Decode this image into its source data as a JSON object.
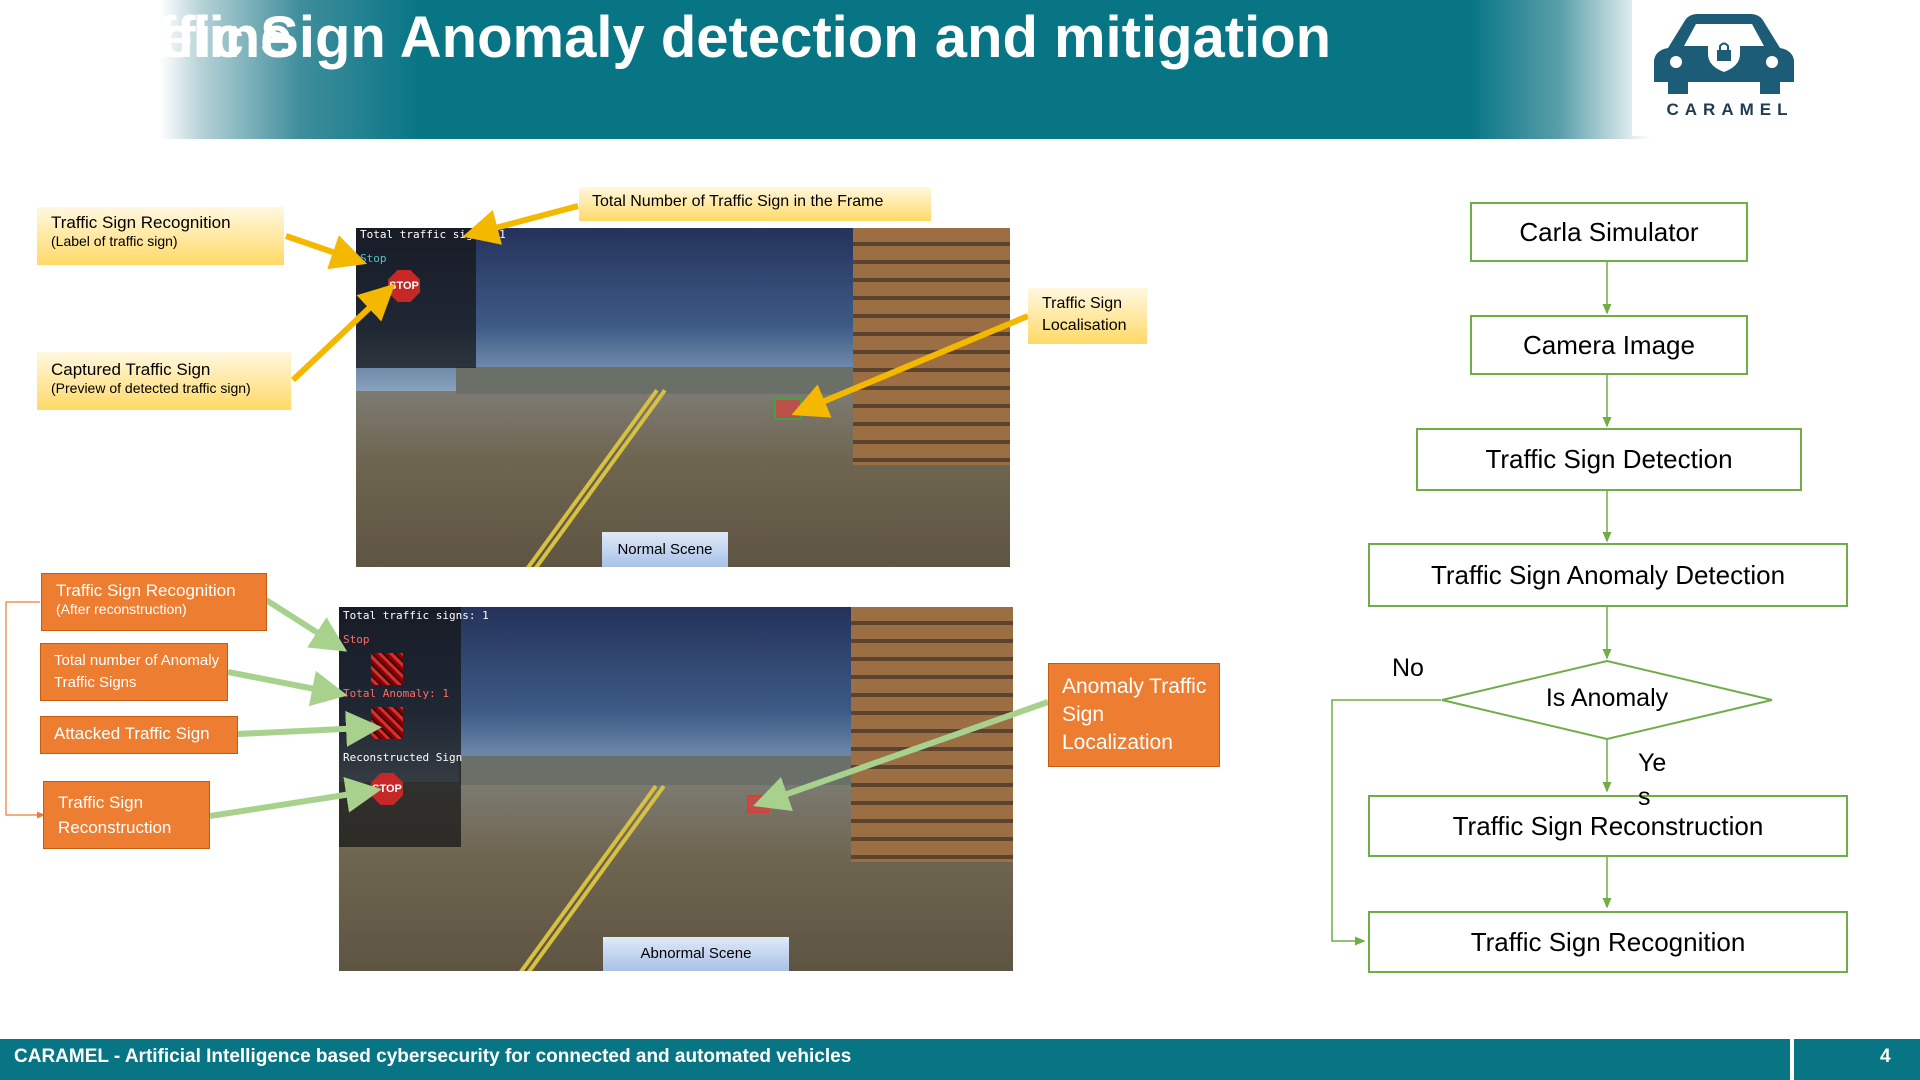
{
  "header": {
    "title_line1": "Traffic Sign Anomaly detection and mitigation",
    "title_line2": "Pipeline",
    "logo_text": "CARAMEL",
    "logo_icon": "car-lock-icon"
  },
  "normal_scene": {
    "overlay_total": "Total traffic signs: 1",
    "overlay_label": "Stop",
    "stop_text": "STOP",
    "bbox_text": "STOP",
    "caption": "Normal Scene"
  },
  "abnormal_scene": {
    "overlay_total": "Total traffic signs: 1",
    "overlay_label": "Stop",
    "overlay_anomaly": "Total Anomaly: 1",
    "overlay_reconstructed": "Reconstructed Sign",
    "stop_text": "STOP",
    "caption": "Abnormal Scene"
  },
  "annotations": {
    "tsr_main": "Traffic Sign Recognition",
    "tsr_sub": "(Label of traffic sign)",
    "captured_main": "Captured Traffic Sign",
    "captured_sub": "(Preview of detected traffic sign)",
    "total_frame": "Total Number of Traffic Sign in the Frame",
    "localisation": "Traffic Sign Localisation",
    "tsr_after_main": "Traffic Sign Recognition",
    "tsr_after_sub": "(After reconstruction)",
    "total_anomaly": "Total number of Anomaly Traffic Signs",
    "attacked": "Attacked Traffic Sign",
    "reconstruction": "Traffic Sign Reconstruction",
    "anomaly_localization": "Anomaly Traffic Sign Localization"
  },
  "flowchart": {
    "steps": [
      "Carla Simulator",
      "Camera Image",
      "Traffic Sign Detection",
      "Traffic Sign Anomaly Detection",
      "Is Anomaly",
      "Traffic Sign Reconstruction",
      "Traffic Sign Recognition"
    ],
    "no_label": "No",
    "yes_label_a": "Ye",
    "yes_label_b": "s"
  },
  "footer": {
    "text": "CARAMEL - Artificial Intelligence based cybersecurity for connected and automated vehicles",
    "page_number": "4"
  },
  "colors": {
    "header_teal": "#087585",
    "flow_green": "#70ad47",
    "annotation_orange": "#ed7d31",
    "annotation_yellow": "#ffd966",
    "arrow_yellow": "#f5b800",
    "arrow_green": "#a9d18e"
  }
}
